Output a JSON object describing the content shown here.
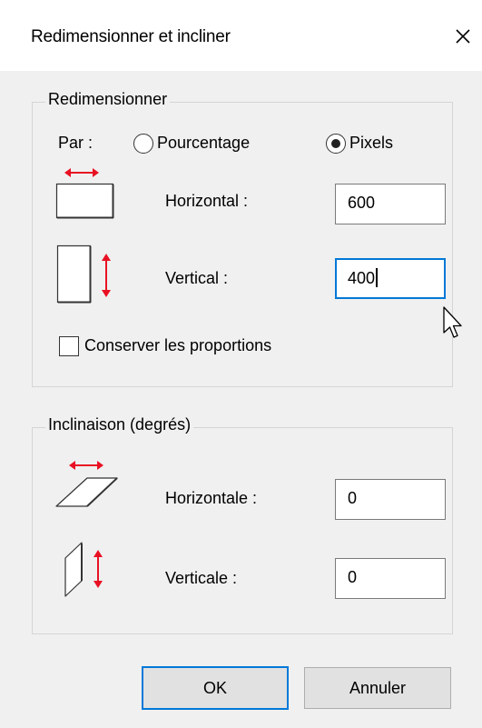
{
  "dialog": {
    "title": "Redimensionner et incliner"
  },
  "resize": {
    "legend": "Redimensionner",
    "by_label": "Par :",
    "percent_label": "Pourcentage",
    "pixels_label": "Pixels",
    "selected_mode": "Pixels",
    "horizontal_label": "Horizontal :",
    "horizontal_value": "600",
    "vertical_label": "Vertical :",
    "vertical_value": "400",
    "keep_ratio_label": "Conserver les proportions",
    "keep_ratio_checked": false
  },
  "skew": {
    "legend": "Inclinaison (degrés)",
    "horizontal_label": "Horizontale :",
    "horizontal_value": "0",
    "vertical_label": "Verticale :",
    "vertical_value": "0"
  },
  "buttons": {
    "ok": "OK",
    "cancel": "Annuler"
  },
  "colors": {
    "accent": "#0078d7",
    "arrow": "#e81123"
  },
  "icons": [
    "close-icon",
    "resize-horizontal-icon",
    "resize-vertical-icon",
    "skew-horizontal-icon",
    "skew-vertical-icon",
    "mouse-cursor-icon"
  ]
}
